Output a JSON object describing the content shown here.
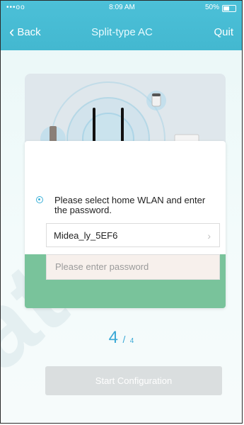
{
  "status": {
    "signal": "•••oo",
    "time": "8:09 AM",
    "battery": "50%"
  },
  "nav": {
    "back_label": "Back",
    "title": "Split-type AC",
    "quit_label": "Quit"
  },
  "form": {
    "instruction": "Please select home WLAN and enter the password.",
    "ssid_value": "Midea_ly_5EF6",
    "password_placeholder": "Please enter password"
  },
  "step": {
    "current": "4",
    "separator": "/",
    "total": "4"
  },
  "actions": {
    "start_label": "Start Configuration"
  },
  "colors": {
    "accent": "#43b8d0",
    "green_band": "#79c39b",
    "disabled_button": "#dadedf"
  }
}
